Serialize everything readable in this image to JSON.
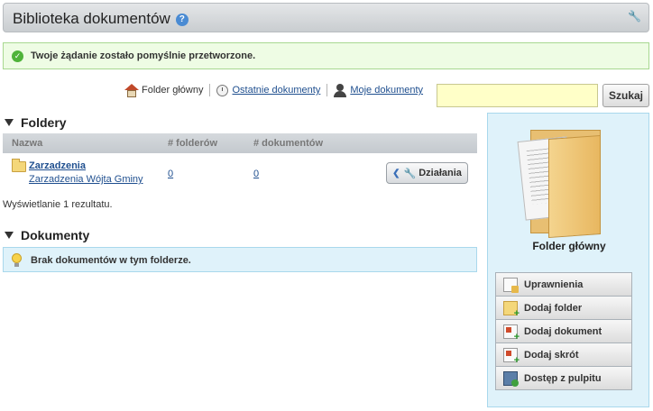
{
  "window": {
    "title": "Biblioteka dokumentów",
    "help_icon": "help-icon",
    "settings_icon": "wrench-icon"
  },
  "success_message": "Twoje żądanie zostało pomyślnie przetworzone.",
  "nav": {
    "home": "Folder główny",
    "recent": "Ostatnie dokumenty",
    "mine": "Moje dokumenty"
  },
  "search": {
    "value": "",
    "placeholder": "",
    "button": "Szukaj"
  },
  "folders_section": {
    "title": "Foldery",
    "columns": [
      "Nazwa",
      "# folderów",
      "# dokumentów"
    ],
    "rows": [
      {
        "name": "Zarzadzenia",
        "description": "Zarzadzenia Wójta Gminy",
        "folders": "0",
        "documents": "0",
        "action": "Działania"
      }
    ],
    "results_text": "Wyświetlanie 1 rezultatu."
  },
  "documents_section": {
    "title": "Dokumenty",
    "empty_message": "Brak dokumentów w tym folderze."
  },
  "sidebar": {
    "caption": "Folder główny",
    "menu": [
      {
        "label": "Uprawnienia",
        "icon": "permissions-icon"
      },
      {
        "label": "Dodaj folder",
        "icon": "add-folder-icon"
      },
      {
        "label": "Dodaj dokument",
        "icon": "add-document-icon"
      },
      {
        "label": "Dodaj skrót",
        "icon": "add-shortcut-icon"
      },
      {
        "label": "Dostęp z pulpitu",
        "icon": "desktop-access-icon"
      }
    ]
  },
  "colors": {
    "link": "#1f4f8f",
    "success_bg": "#eefce4",
    "info_bg": "#dff2fa",
    "search_bg": "#ffffc8"
  }
}
